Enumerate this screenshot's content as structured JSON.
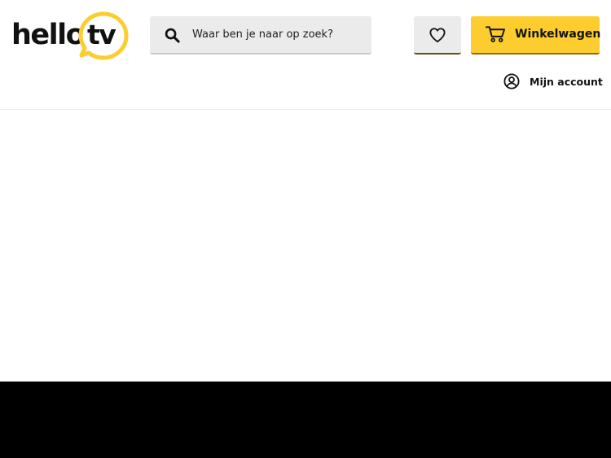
{
  "logo": {
    "word": "hello",
    "tv": "tv",
    "brand_color": "#fdcd2f",
    "icon": "speech-bubble-icon"
  },
  "search": {
    "placeholder": "Waar ben je naar op zoek?",
    "value": "",
    "icon": "search-icon"
  },
  "wishlist": {
    "icon": "heart-icon"
  },
  "cart": {
    "label": "Winkelwagen",
    "icon": "cart-icon",
    "color": "#fdcd2f"
  },
  "account": {
    "label": "Mijn account",
    "icon": "user-icon"
  },
  "colors": {
    "background": "#ffffff",
    "search_bg": "#ebebeb",
    "footer": "#000000",
    "text": "#111111"
  }
}
